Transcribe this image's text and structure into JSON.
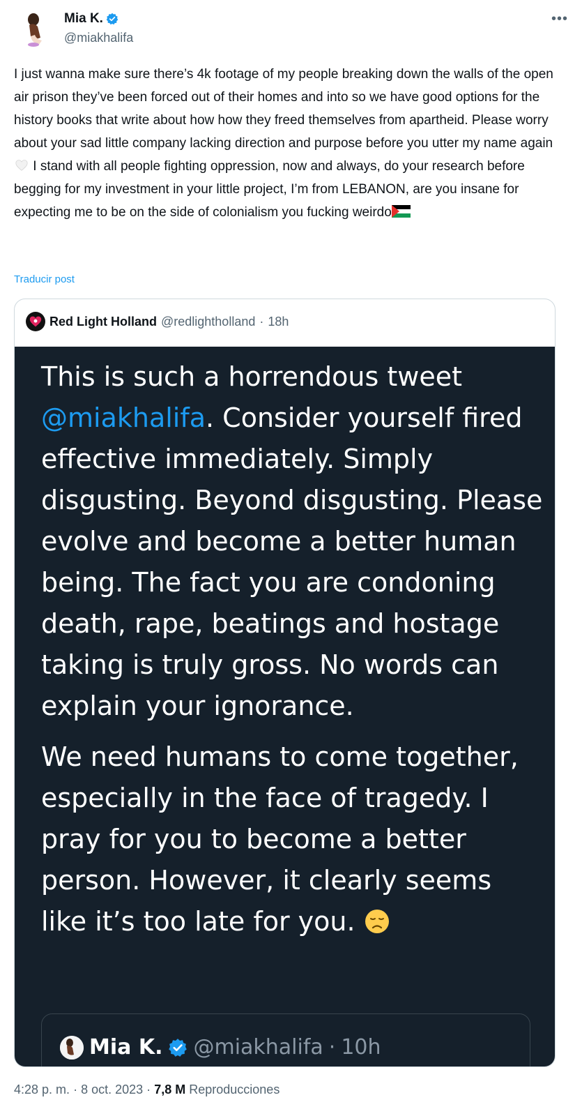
{
  "author": {
    "display_name": "Mia K.",
    "handle": "@miakhalifa",
    "verified": true,
    "more_icon": "more-horizontal-icon"
  },
  "tweet": {
    "text_part1": "I just wanna make sure there’s 4k footage of my people breaking down the walls of the open air prison they’ve been forced out of their homes and into so we have good options for the history books that write about how how they freed themselves from apartheid. Please worry about your sad little company lacking direction and purpose before you utter my name again",
    "text_part2": " I stand with all people fighting oppression, now and always, do your research before begging for my investment in your little project, I’m from LEBANON, are you insane for expecting me to be on the side of colonialism you fucking weirdo",
    "emoji_heart": "white-heart-icon",
    "emoji_flag": "palestine-flag-icon",
    "translate_label": "Traducir post"
  },
  "quote": {
    "display_name": "Red Light Holland",
    "handle": "@redlightholland",
    "separator": "·",
    "time": "18h",
    "image_text": {
      "p1_before": "This is such a horrendous tweet ",
      "p1_mention": "@miakhalifa",
      "p1_after": ". Consider yourself fired effective immediately. Simply disgusting. Beyond disgusting. Please evolve and become a better human being. The fact you are condoning death, rape, beatings and hostage taking is truly gross. No words can explain your ignorance.",
      "p2": "We need humans to come together, especially in the face of tragedy. I pray for you to become a better person. However, it clearly seems like it’s too late for you. ",
      "emoji": "disappointed-face-icon"
    },
    "inner": {
      "display_name": "Mia K.",
      "handle": "@miakhalifa",
      "separator": "·",
      "time": "10h"
    }
  },
  "meta": {
    "time": "4:28 p. m.",
    "separator": "·",
    "date": "8 oct. 2023",
    "separator2": "·",
    "views": "7,8 M",
    "views_label": "Reproducciones"
  },
  "colors": {
    "accent": "#1d9bf0",
    "quote_bg": "#15202b",
    "secondary_text": "#536471"
  }
}
